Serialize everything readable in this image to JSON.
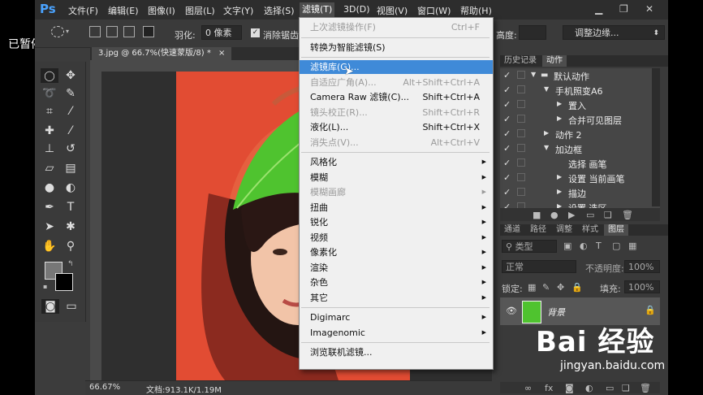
{
  "overlay": {
    "paused_label": "已暂停"
  },
  "app": {
    "logo": "Ps"
  },
  "menubar": {
    "items": [
      "文件(F)",
      "编辑(E)",
      "图像(I)",
      "图层(L)",
      "文字(Y)",
      "选择(S)",
      "滤镜(T)",
      "3D(D)",
      "视图(V)",
      "窗口(W)",
      "帮助(H)"
    ],
    "active": "滤镜(T)"
  },
  "options_bar": {
    "feather_label": "羽化:",
    "feather_value": "0 像素",
    "antialias_label": "消除锯齿",
    "height_label": "高度:",
    "refine_edge_label": "调整边缘..."
  },
  "document_tab": {
    "title": "3.jpg @ 66.7%(快速蒙版/8) *"
  },
  "filter_menu": {
    "items": [
      {
        "label": "上次滤镜操作(F)",
        "shortcut": "Ctrl+F",
        "disabled": true
      },
      {
        "separator": true
      },
      {
        "label": "转换为智能滤镜(S)",
        "shortcut": "",
        "disabled": false
      },
      {
        "separator": true
      },
      {
        "label": "滤镜库(G)...",
        "shortcut": "",
        "highlighted": true
      },
      {
        "label": "自适应广角(A)...",
        "shortcut": "Alt+Shift+Ctrl+A",
        "disabled": true
      },
      {
        "label": "Camera Raw 滤镜(C)...",
        "shortcut": "Shift+Ctrl+A"
      },
      {
        "label": "镜头校正(R)...",
        "shortcut": "Shift+Ctrl+R",
        "disabled": true
      },
      {
        "label": "液化(L)...",
        "shortcut": "Shift+Ctrl+X"
      },
      {
        "label": "消失点(V)...",
        "shortcut": "Alt+Ctrl+V",
        "disabled": true
      },
      {
        "separator": true
      },
      {
        "label": "风格化",
        "submenu": true
      },
      {
        "label": "模糊",
        "submenu": true
      },
      {
        "label": "模糊画廊",
        "submenu": true,
        "disabled": true
      },
      {
        "label": "扭曲",
        "submenu": true
      },
      {
        "label": "锐化",
        "submenu": true
      },
      {
        "label": "视频",
        "submenu": true
      },
      {
        "label": "像素化",
        "submenu": true
      },
      {
        "label": "渲染",
        "submenu": true
      },
      {
        "label": "杂色",
        "submenu": true
      },
      {
        "label": "其它",
        "submenu": true
      },
      {
        "separator": true
      },
      {
        "label": "Digimarc",
        "submenu": true
      },
      {
        "label": "Imagenomic",
        "submenu": true
      },
      {
        "separator": true
      },
      {
        "label": "浏览联机滤镜..."
      }
    ]
  },
  "history_panel": {
    "tabs": [
      "历史记录",
      "动作"
    ],
    "active_tab": "动作",
    "rows": [
      {
        "label": "默认动作",
        "level": 0,
        "expanded": true,
        "folder": true
      },
      {
        "label": "手机照变A6",
        "level": 1,
        "expanded": true
      },
      {
        "label": "置入",
        "level": 2,
        "expanded": false
      },
      {
        "label": "合并可见图层",
        "level": 2,
        "expanded": false
      },
      {
        "label": "动作 2",
        "level": 1,
        "expanded": false
      },
      {
        "label": "加边框",
        "level": 1,
        "expanded": true
      },
      {
        "label": "选择 画笔",
        "level": 2,
        "expanded": null
      },
      {
        "label": "设置 当前画笔",
        "level": 2,
        "expanded": false
      },
      {
        "label": "描边",
        "level": 2,
        "expanded": false
      },
      {
        "label": "设置 选区",
        "level": 2,
        "expanded": false
      }
    ]
  },
  "layers_panel": {
    "tabs": [
      "通道",
      "路径",
      "调整",
      "样式",
      "图层"
    ],
    "active_tab": "图层",
    "filter_kind": "类型",
    "blend_mode": "正常",
    "opacity_label": "不透明度:",
    "opacity_value": "100%",
    "lock_label": "锁定:",
    "fill_label": "填充:",
    "fill_value": "100%",
    "layer_name": "背景"
  },
  "status_bar": {
    "zoom": "66.67%",
    "doc_info": "文档:913.1K/1.19M"
  },
  "watermark": {
    "brand": "Bai  经验",
    "url": "jingyan.baidu.com"
  },
  "colors": {
    "menu_highlight": "#3f8ad8",
    "photo_background": "#e5603f",
    "leaf_green": "#4fc32f",
    "app_chrome": "#3c3c3c"
  }
}
